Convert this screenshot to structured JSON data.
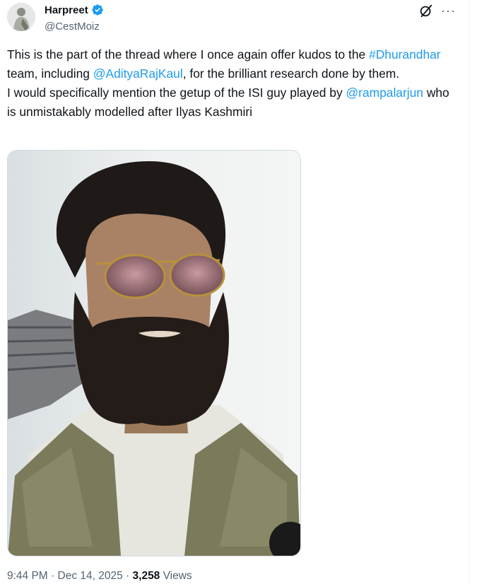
{
  "author": {
    "display_name": "Harpreet",
    "handle": "@CestMoiz",
    "verified_icon": "verified-badge-icon"
  },
  "actions": {
    "grok_icon": "grok-icon",
    "more_label": "···"
  },
  "tweet": {
    "line1_a": "This is the part of the thread where I once again offer kudos to the ",
    "hashtag": "#Dhurandhar",
    "line1_b": " team, including ",
    "mention1": "@AdityaRajKaul",
    "line1_c": ", for the brilliant research done by them.",
    "line2_a": "I would specifically mention the getup of the ISI guy played by ",
    "mention2": "@rampalarjun",
    "line2_b": " who is unmistakably modelled after Ilyas Kashmiri"
  },
  "meta": {
    "time": "9:44 PM",
    "sep1": " · ",
    "date": "Dec 14, 2025",
    "sep2": " · ",
    "views_count": "3,258",
    "views_label": " Views"
  },
  "colors": {
    "link": "#1d9bf0",
    "verified": "#1d9bf0",
    "secondary": "#536471"
  }
}
